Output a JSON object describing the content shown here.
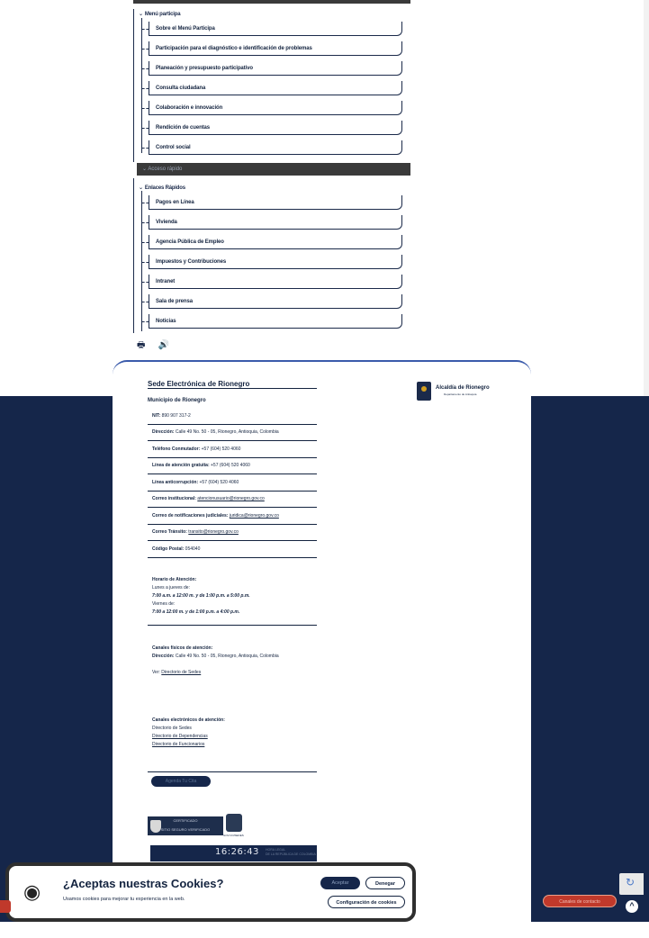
{
  "menu": {
    "section1_title": "Menú participa",
    "section1_items": [
      "Sobre el Menú Participa",
      "Participación para el diagnóstico e identificación de problemas",
      "Planeación y presupuesto participativo",
      "Consulta ciudadana",
      "Colaboración e innovación",
      "Rendición de cuentas",
      "Control social"
    ],
    "dark_band_label": "Acceso rápido",
    "section2_title": "Enlaces Rápidos",
    "section2_items": [
      "Pagos en Línea",
      "Vivienda",
      "Agencia Pública de Empleo",
      "Impuestos y Contribuciones",
      "Intranet",
      "Sala de prensa",
      "Noticias"
    ]
  },
  "footer": {
    "title": "Sede Electrónica de Rionegro",
    "municipality": "Municipio de Rionegro",
    "nit_label": "NIT:",
    "nit": "890 907 317-2",
    "address_label": "Dirección:",
    "address": "Calle 49 No. 50 - 05, Rionegro, Antioquia, Colombia",
    "phone_label": "Teléfono Conmutador:",
    "phone": "+57 (604) 520 4060",
    "free_line_label": "Línea de atención gratuita:",
    "free_line": "+57 (604) 520 4060",
    "anticorruption_label": "Línea anticorrupción:",
    "anticorruption": "+57 (604) 520 4060",
    "email_label": "Correo institucional:",
    "email": "atencionusuario@rionegro.gov.co",
    "judicial_label": "Correo de notificaciones judiciales:",
    "judicial": "juridica@rionegro.gov.co",
    "transit_label": "Correo Tránsito:",
    "transit": "transito@rionegro.gov.co",
    "postal_label": "Código Postal:",
    "postal": "054040",
    "hours_title": "Horario de Atención:",
    "hours_line1": "Lunes a jueves de:",
    "hours_line2": "7:00 a.m. a 12:00 m. y de 1:00 p.m. a 5:00 p.m.",
    "hours_line3": "Viernes de:",
    "hours_line4": "7:00 a 12:00 m. y de 1:00 p.m. a 4:00 p.m.",
    "physical_title": "Canales físicos de atención:",
    "physical_label": "Dirección:",
    "physical": "Calle 49 No. 50 - 05, Rionegro, Antioquia, Colombia",
    "see_label": "Ver:",
    "see_link": "Directorio de Sedes",
    "electronic_title": "Canales electrónicos de atención:",
    "electronic_1": "Directorio de Sedes",
    "electronic_2": "Directorio de Dependencias",
    "electronic_3": "Directorio de Funcionarios",
    "schedule_button": "Agenda Tu Cita",
    "seal_text": "CERTIFICADO",
    "seal_text2": "SITIO SEGURO VERIFICADO",
    "badge_label": "GOV.CO/SEDES",
    "clock_time": "16:26:43",
    "clock_side1": "HORA LEGAL",
    "clock_side2": "DE LA REPÚBLICA DE COLOMBIA",
    "logo_name": "Alcaldía de Rionegro",
    "logo_sub": "Departamento de Antioquia"
  },
  "cookies": {
    "title": "¿Aceptas nuestras Cookies?",
    "subtitle": "Usamos cookies para mejorar tu experiencia en la web.",
    "accept": "Aceptar",
    "deny": "Denegar",
    "config": "Configuración de cookies"
  },
  "floating": {
    "contact": "Canales de contacto"
  },
  "icons": {
    "print": "printer-icon",
    "audio": "speaker-icon",
    "cookie": "cookie-icon",
    "scroll_top": "chevron-up-icon"
  }
}
